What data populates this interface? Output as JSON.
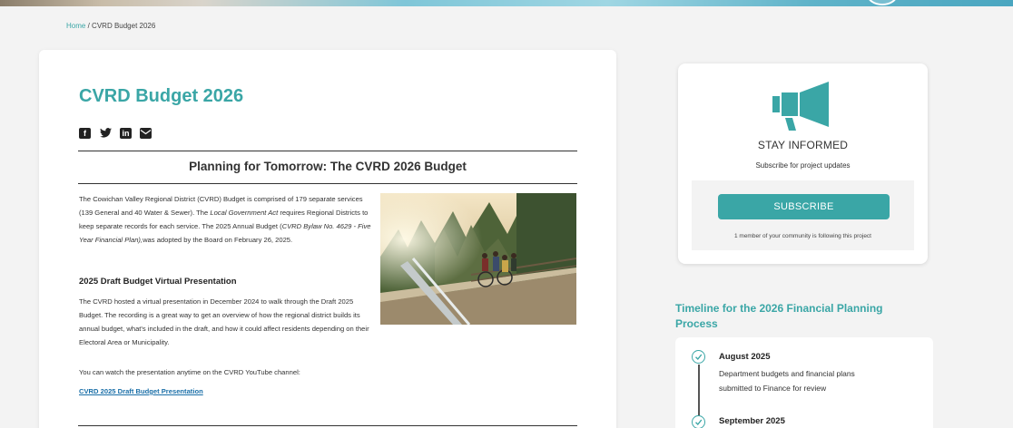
{
  "breadcrumb": {
    "home": "Home",
    "separator": "/",
    "current": "CVRD Budget 2026"
  },
  "page": {
    "title": "CVRD Budget 2026",
    "share_icons": [
      "facebook-icon",
      "twitter-icon",
      "linkedin-icon",
      "email-icon"
    ],
    "subtitle": "Planning for Tomorrow: The CVRD 2026 Budget",
    "para1_a": "The Cowichan Valley Regional District (CVRD) Budget is comprised of 179 separate services (139 General and 40 Water & Sewer). The ",
    "para1_em": "Local Government Act",
    "para1_b": " requires Regional Districts to keep separate records for each service. The 2025 Annual Budget (",
    "para1_em2": "CVRD Bylaw No. 4629 - Five Year Financial Plan),",
    "para1_c": "was adopted by the Board on February 26, 2025.",
    "heading2": "2025 Draft Budget Virtual Presentation",
    "para2": "The CVRD hosted a virtual presentation in December 2024 to walk through the Draft 2025 Budget. The recording is a great way to get an overview of how the regional district builds its annual budget, what's included in the draft, and how it could affect residents depending on their Electoral Area or Municipality.",
    "para3": "You can watch the presentation anytime on the CVRD YouTube channel:",
    "link": "CVRD 2025 Draft Budget Presentation"
  },
  "sidebar": {
    "stay_informed": "STAY INFORMED",
    "subscribe_note": "Subscribe for project updates",
    "subscribe_button": "SUBSCRIBE",
    "followers": "1 member of your community is following this project",
    "timeline_title": "Timeline for the 2026 Financial Planning Process",
    "timeline": [
      {
        "month": "August 2025",
        "desc": "Department budgets and financial plans submitted to Finance for review"
      },
      {
        "month": "September 2025",
        "desc": ""
      }
    ]
  },
  "colors": {
    "accent": "#3aa6a6",
    "link": "#1a6fa8"
  }
}
